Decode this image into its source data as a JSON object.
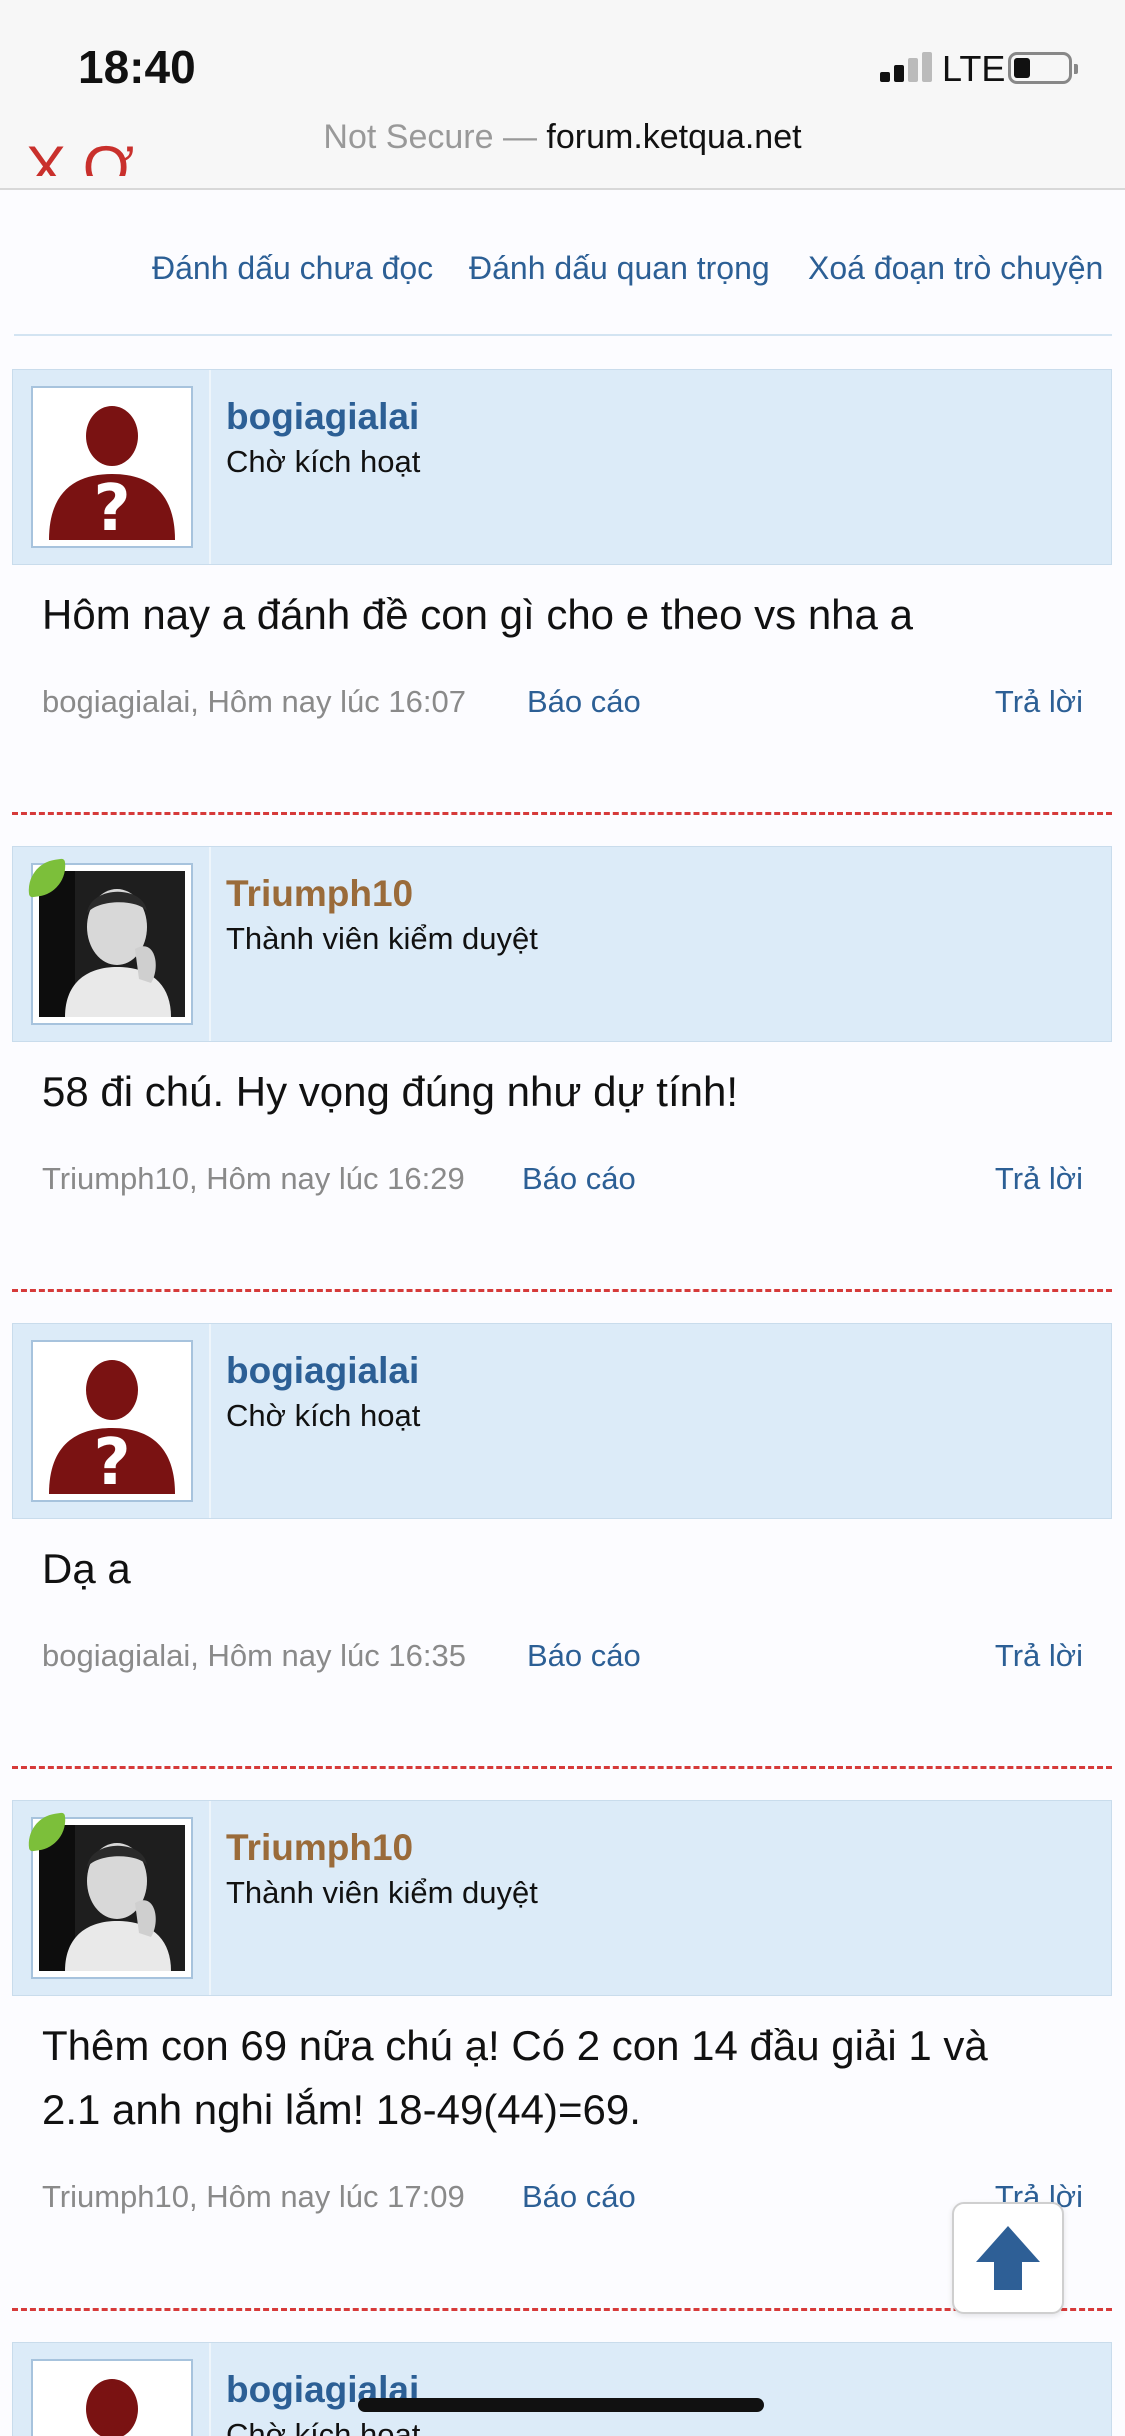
{
  "status_bar": {
    "time": "18:40",
    "network": "LTE",
    "url_prefix": "Not Secure — ",
    "url_domain": "forum.ketqua.net"
  },
  "page_title_partial": "X Ơ",
  "actions": {
    "mark_unread": "Đánh dấu chưa đọc",
    "mark_important": "Đánh dấu quan trọng",
    "delete_conversation": "Xoá đoạn trò chuyện"
  },
  "posts": [
    {
      "username": "bogiagialai",
      "role": "Chờ kích hoạt",
      "message": "Hôm nay a đánh đề con gì cho e theo vs nha a",
      "meta": "bogiagialai, Hôm nay lúc 16:07",
      "report": "Báo cáo",
      "reply": "Trả lời"
    },
    {
      "username": "Triumph10",
      "role": "Thành viên kiểm duyệt",
      "message": "58 đi chú. Hy vọng đúng như dự tính!",
      "meta": "Triumph10, Hôm nay lúc 16:29",
      "report": "Báo cáo",
      "reply": "Trả lời"
    },
    {
      "username": "bogiagialai",
      "role": "Chờ kích hoạt",
      "message": "Dạ a",
      "meta": "bogiagialai, Hôm nay lúc 16:35",
      "report": "Báo cáo",
      "reply": "Trả lời"
    },
    {
      "username": "Triumph10",
      "role": "Thành viên kiểm duyệt",
      "message_line1": "Thêm con 69 nữa chú ạ! Có 2 con 14 đầu giải 1 và",
      "message_line2": "2.1 anh nghi lắm! 18-49(44)=69.",
      "meta": "Triumph10, Hôm nay lúc 17:09",
      "report": "Báo cáo",
      "reply": "Trả lời"
    },
    {
      "username": "bogiagialai",
      "role": "Chờ kích hoạt"
    }
  ],
  "colors": {
    "link": "#2c5f95",
    "moderator_name": "#9a6b3a",
    "post_header_bg": "#dcebf8",
    "separator": "#d63a3a"
  }
}
